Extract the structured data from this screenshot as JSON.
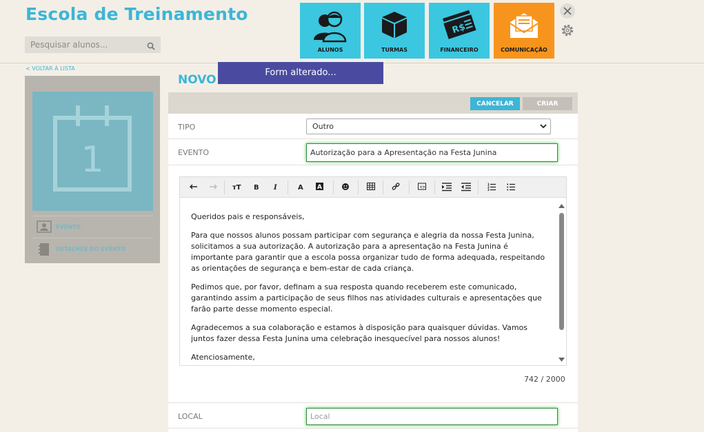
{
  "app": {
    "title": "Escola de Treinamento"
  },
  "search": {
    "placeholder": "Pesquisar alunos..."
  },
  "nav": [
    {
      "label": "ALUNOS",
      "icon": "students-icon"
    },
    {
      "label": "TURMAS",
      "icon": "box-icon"
    },
    {
      "label": "FINANCEIRO",
      "icon": "money-icon"
    },
    {
      "label": "COMUNICAÇÃO",
      "icon": "mail-icon"
    }
  ],
  "colors": {
    "accent": "#3db5d6",
    "nav_tile": "#3bc7e0",
    "nav_active": "#f7941d",
    "toast": "#4a4ba0"
  },
  "sidebar": {
    "back": "< VOLTAR À LISTA",
    "calendar_day": "1",
    "items": [
      {
        "label": "EVENTO",
        "icon": "id-card-icon"
      },
      {
        "label": "DETALHES DO EVENTO",
        "icon": "notebook-icon"
      }
    ]
  },
  "toast": "Form alterado...",
  "page_title": "NOVO EVENTO",
  "actions": {
    "cancel": "CANCELAR",
    "create": "CRIAR"
  },
  "form": {
    "tipo_label": "TIPO",
    "tipo_value": "Outro",
    "evento_label": "EVENTO",
    "evento_value": "Autorização para a Apresentação na Festa Junina",
    "local_label": "LOCAL",
    "local_placeholder": "Local"
  },
  "editor": {
    "paragraphs": [
      "Queridos pais e responsáveis,",
      "Para que nossos alunos possam participar com segurança e alegria da nossa Festa Junina, solicitamos a sua autorização. A autorização para a apresentação na Festa Junina é importante para garantir que a escola possa organizar tudo de forma adequada, respeitando as orientações de segurança e bem-estar de cada criança.",
      "Pedimos que, por favor, definam a sua resposta quando receberem este comunicado, garantindo assim a participação de seus filhos nas atividades culturais e apresentações que farão parte desse momento especial.",
      "Agradecemos a sua colaboração e estamos à disposição para quaisquer dúvidas. Vamos juntos fazer dessa Festa Junina uma celebração inesquecível para nossos alunos!",
      "Atenciosamente,"
    ],
    "counter": "742 / 2000"
  }
}
